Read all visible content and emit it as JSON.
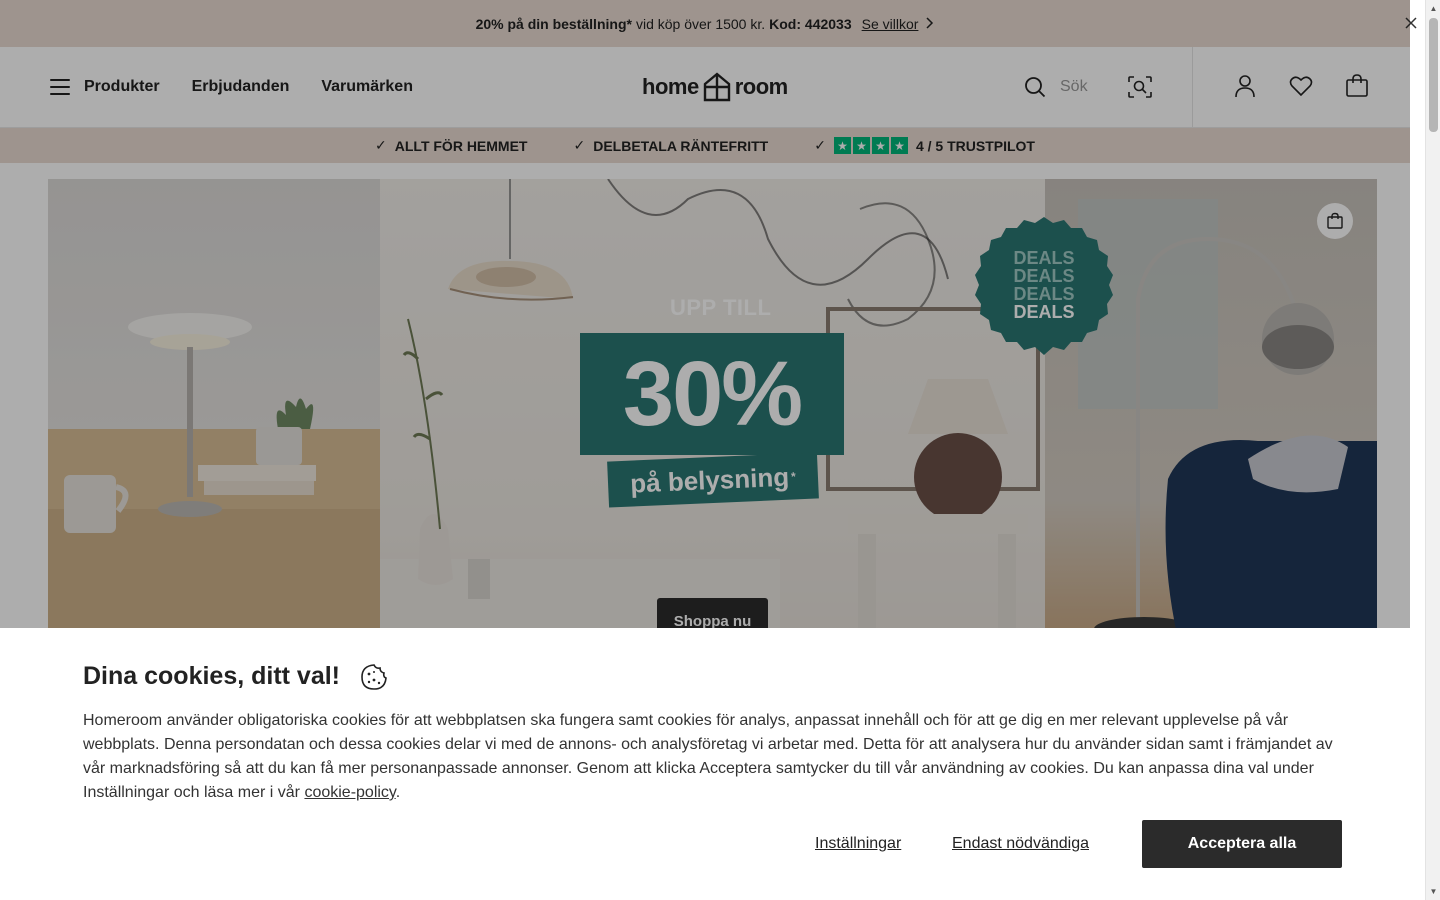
{
  "promo": {
    "bold1": "20% på din beställning*",
    "text": "vid köp över 1500 kr.",
    "code_label": "Kod: 442033",
    "link": "Se villkor"
  },
  "header": {
    "nav": [
      "Produkter",
      "Erbjudanden",
      "Varumärken"
    ],
    "logo_left": "home",
    "logo_right": "room",
    "search_placeholder": "Sök"
  },
  "usp": {
    "item1": "ALLT FÖR HEMMET",
    "item2": "DELBETALA RÄNTEFRITT",
    "rating": "4 / 5 TRUSTPILOT",
    "check": "✓"
  },
  "hero": {
    "upp": "UPP TILL",
    "percent": "30%",
    "sub": "på belysning",
    "sub_sup": "*",
    "deals": [
      "DEALS",
      "DEALS",
      "DEALS",
      "DEALS"
    ],
    "cta": "Shoppa nu"
  },
  "cookie": {
    "title": "Dina cookies, ditt val!",
    "body": "Homeroom använder obligatoriska cookies för att webbplatsen ska fungera samt cookies för analys, anpassat innehåll och för att ge dig en mer relevant upplevelse på vår webbplats. Denna persondatan och dessa cookies delar vi med de annons- och analysföretag vi arbetar med. Detta för att analysera hur du använder sidan samt i främjandet av vår marknadsföring så att du kan få mer personanpassade annonser. Genom att klicka Acceptera samtycker du till vår användning av cookies. Du kan anpassa dina val under Inställningar och läsa mer i vår ",
    "policy_link": "cookie-policy",
    "period": ".",
    "settings": "Inställningar",
    "necessary": "Endast nödvändiga",
    "accept": "Acceptera alla"
  },
  "colors": {
    "teal": "#2a7672",
    "beige": "#e9dbd2",
    "trustpilot": "#00b67a",
    "dark": "#2b2b2b"
  }
}
